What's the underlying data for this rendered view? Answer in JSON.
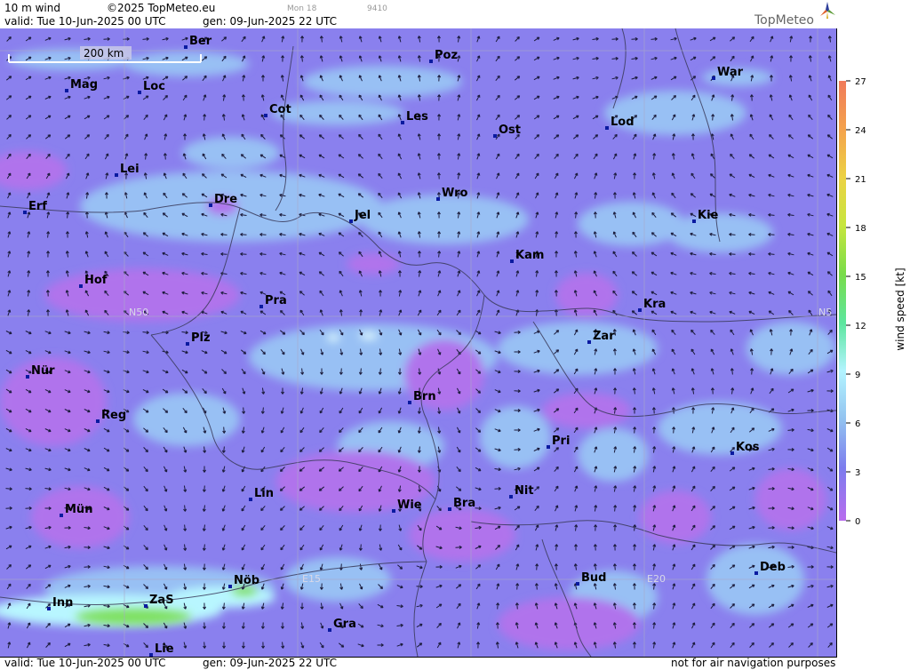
{
  "header": {
    "title": "10 m wind",
    "copyright": "©2025 TopMeteo.eu",
    "run_label": "Mon 18",
    "code": "9410",
    "valid": "valid:  Tue  10-Jun-2025  00 UTC",
    "generated": "gen: 09-Jun-2025 22 UTC",
    "brand": "TopMeteo"
  },
  "footer": {
    "valid": "valid:  Tue  10-Jun-2025  00 UTC",
    "generated": "gen: 09-Jun-2025 22 UTC",
    "disclaimer": "not for air navigation purposes"
  },
  "map": {
    "scale_label": "200 km",
    "grid_labels": [
      "N50",
      "N5",
      "E15",
      "E20"
    ],
    "cities": [
      "Ber",
      "Poz",
      "War",
      "Mag",
      "Loc",
      "Cot",
      "Les",
      "Lod",
      "Ost",
      "Lei",
      "Dre",
      "Wro",
      "Erf",
      "Jel",
      "Kie",
      "Kam",
      "Hof",
      "Kra",
      "Pra",
      "Zar",
      "Plz",
      "Nür",
      "Brn",
      "Reg",
      "Pri",
      "Kos",
      "Lin",
      "Nit",
      "Wie",
      "Bra",
      "Mün",
      "Deb",
      "Nöb",
      "Bud",
      "Inn",
      "ZaS",
      "Gra",
      "Lie"
    ]
  },
  "legend": {
    "unit_label": "wind  speed  [kt]",
    "ticks": [
      "27",
      "24",
      "21",
      "18",
      "15",
      "12",
      "9",
      "6",
      "3",
      "0"
    ],
    "colors": [
      "#f07a5a",
      "#f4a24c",
      "#ecd244",
      "#c6e63e",
      "#78dc4a",
      "#5ce69e",
      "#b2f4ff",
      "#92c2f0",
      "#7c7cee",
      "#b86cee"
    ]
  },
  "colors": {
    "base": "#8a80ee",
    "light": "#98c0f4",
    "purple": "#b073ec",
    "mid": "#7c7cef",
    "green": "#7ee05e",
    "cyan": "#b8f6ff"
  }
}
